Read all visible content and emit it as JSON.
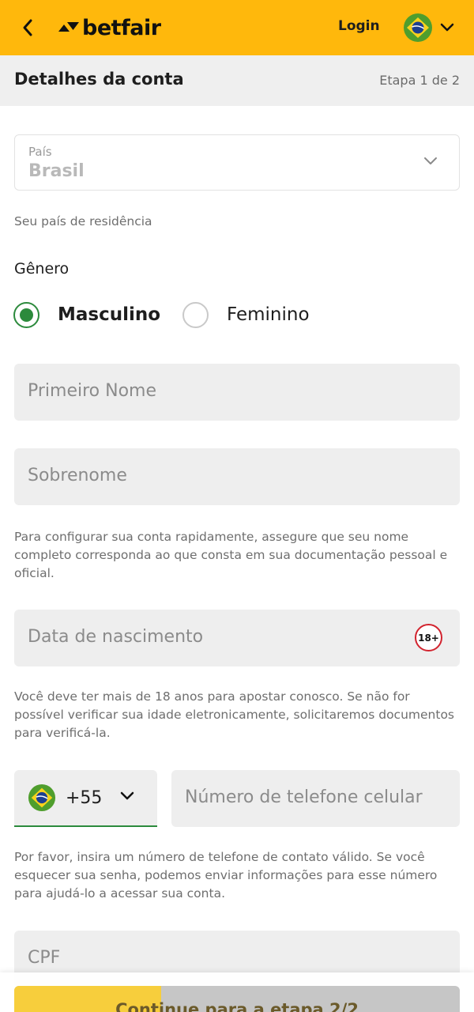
{
  "header": {
    "brand": "betfair",
    "login_label": "Login",
    "language_flag": "brazil-flag-icon"
  },
  "subheader": {
    "title": "Detalhes da conta",
    "step": "Etapa 1 de 2"
  },
  "country": {
    "label": "País",
    "value": "Brasil",
    "helper": "Seu país de residência"
  },
  "gender": {
    "label": "Gênero",
    "options": [
      {
        "label": "Masculino",
        "selected": true
      },
      {
        "label": "Feminino",
        "selected": false
      }
    ]
  },
  "first_name": {
    "placeholder": "Primeiro Nome",
    "value": ""
  },
  "last_name": {
    "placeholder": "Sobrenome",
    "value": ""
  },
  "name_helper": "Para configurar sua conta rapidamente, assegure que seu nome completo corresponda ao que consta em sua documentação pessoal e oficial.",
  "birth_date": {
    "placeholder": "Data de nascimento",
    "badge": "18+"
  },
  "age_helper": "Você deve ter mais de 18 anos para apostar conosco. Se não for possível verificar sua idade eletronicamente, solicitaremos documentos para verificá-la.",
  "phone": {
    "country_code": "+55",
    "placeholder": "Número de telefone celular",
    "helper": "Por favor, insira um número de telefone de contato válido. Se você esquecer sua senha, podemos enviar informações para esse número para ajudá-lo a acessar sua conta."
  },
  "cpf": {
    "placeholder": "CPF"
  },
  "continue": {
    "label": "Continue para a etapa 2/2",
    "progress": 0.33
  },
  "colors": {
    "brand_yellow": "#ffb80c",
    "accent_green": "#2c8a3c",
    "age_badge_red": "#d2232e"
  }
}
